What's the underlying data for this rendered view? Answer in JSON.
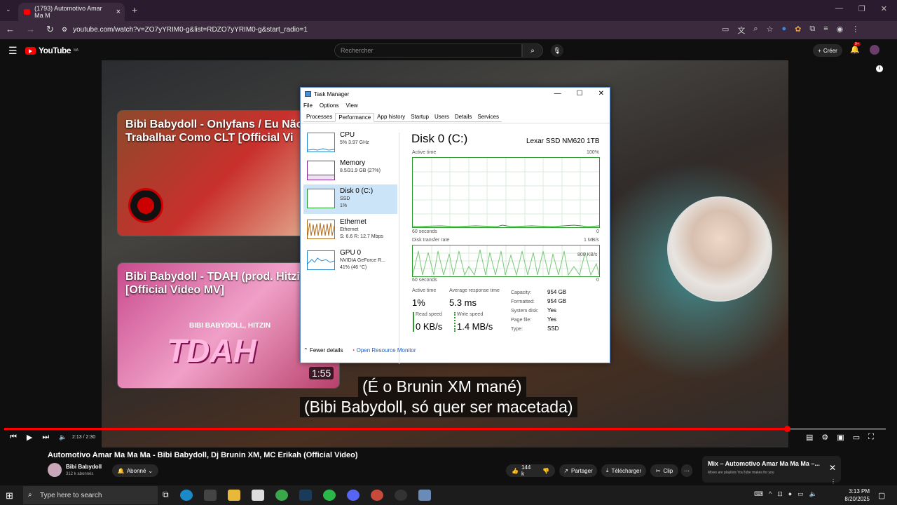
{
  "browser": {
    "tab_title": "(1793) Automotivo Amar Ma M",
    "url": "youtube.com/watch?v=ZO7yYRIM0-g&list=RDZO7yYRIM0-g&start_radio=1"
  },
  "youtube": {
    "logo": "YouTube",
    "logo_region": "MA",
    "search_placeholder": "Rechercher",
    "create_label": "Créer",
    "notif_count": "9+"
  },
  "video": {
    "cards": [
      {
        "title": "Bibi Babydoll - Onlyfans / Eu Não N Pra Trabalhar Como CLT [Official Vi"
      },
      {
        "title": "Bibi Babydoll - TDAH (prod. Hitzin) [Official Video MV]",
        "art_text": "TDAH",
        "art_sub": "BIBI BABYDOLL, HITZIN",
        "duration": "1:55"
      }
    ],
    "subtitle_line1": "(É o Brunin XM mané)",
    "subtitle_line2": "(Bibi Babydoll, só quer ser macetada)",
    "time": "2:13 / 2:30",
    "progress": 0.888
  },
  "meta": {
    "title": "Automotivo Amar Ma Ma Ma - Bibi Babydoll, Dj Brunin XM, MC Erikah (Official Video)",
    "channel": "Bibi Babydoll",
    "subscribers": "312 k abonnés",
    "subscribed": "Abonné",
    "likes": "144 k",
    "share": "Partager",
    "download": "Télécharger",
    "clip": "Clip"
  },
  "mix": {
    "title": "Mix – Automotivo Amar Ma Ma Ma –...",
    "subtitle": "Mixes are playlists YouTube makes for you"
  },
  "task_manager": {
    "title": "Task Manager",
    "menu": [
      "File",
      "Options",
      "View"
    ],
    "tabs": [
      "Processes",
      "Performance",
      "App history",
      "Startup",
      "Users",
      "Details",
      "Services"
    ],
    "selected_tab": "Performance",
    "side": [
      {
        "name": "CPU",
        "d1": "5%  3.97 GHz",
        "d2": "",
        "d3": "",
        "color": "#2a8ad0"
      },
      {
        "name": "Memory",
        "d1": "8.5/31.9 GB (27%)",
        "d2": "",
        "d3": "",
        "color": "#8a2a9a"
      },
      {
        "name": "Disk 0 (C:)",
        "d1": "SSD",
        "d2": "1%",
        "d3": "",
        "color": "#2a9a2a"
      },
      {
        "name": "Ethernet",
        "d1": "Ethernet",
        "d2": "S: 6.6  R: 12.7 Mbps",
        "d3": "",
        "color": "#b06a1a"
      },
      {
        "name": "GPU 0",
        "d1": "NVIDIA GeForce R...",
        "d2": "41% (46 °C)",
        "d3": "",
        "color": "#2a8ad0"
      }
    ],
    "disk_title": "Disk 0 (C:)",
    "disk_model": "Lexar SSD NM620 1TB",
    "graph1_label": "Active time",
    "graph1_max": "100%",
    "graph1_left": "60 seconds",
    "graph1_right": "0",
    "graph2_label": "Disk transfer rate",
    "graph2_max": "1 MB/s",
    "graph2_mark": "800 KB/s",
    "graph2_left": "60 seconds",
    "graph2_right": "0",
    "stats": {
      "active_time_label": "Active time",
      "active_time": "1%",
      "resp_label": "Average response time",
      "resp": "5.3 ms",
      "read_label": "Read speed",
      "read": "0 KB/s",
      "write_label": "Write speed",
      "write": "1.4 MB/s"
    },
    "props": [
      {
        "k": "Capacity:",
        "v": "954 GB"
      },
      {
        "k": "Formatted:",
        "v": "954 GB"
      },
      {
        "k": "System disk:",
        "v": "Yes"
      },
      {
        "k": "Page file:",
        "v": "Yes"
      },
      {
        "k": "Type:",
        "v": "SSD"
      }
    ],
    "fewer": "Fewer details",
    "resmon": "Open Resource Monitor"
  },
  "taskbar": {
    "search": "Type here to search",
    "time": "3:13 PM",
    "date": "8/20/2025"
  }
}
